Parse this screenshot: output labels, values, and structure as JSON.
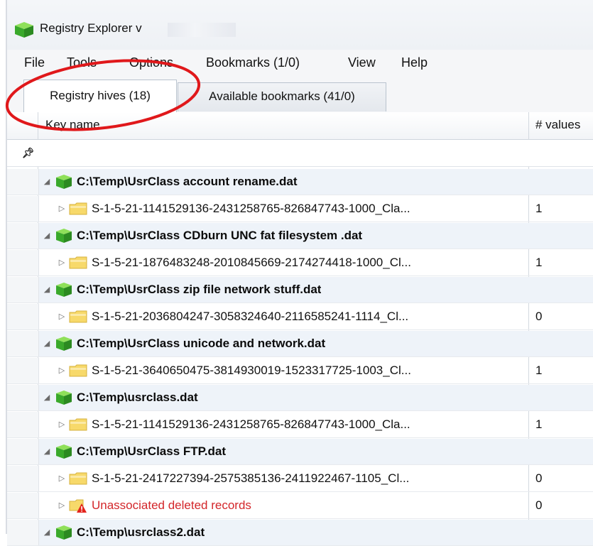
{
  "window": {
    "title": "Registry Explorer v",
    "app_icon": "green-cube-icon"
  },
  "menu": [
    "File",
    "Tools",
    "Options",
    "Bookmarks (1/0)",
    "View",
    "Help"
  ],
  "tabs": [
    {
      "label": "Registry hives (18)",
      "active": true
    },
    {
      "label": "Available bookmarks (41/0)",
      "active": false
    }
  ],
  "grid": {
    "columns": [
      "Key name",
      "# values"
    ],
    "filter_icon": "pin-filter-icon",
    "rows": [
      {
        "type": "hive",
        "name": "C:\\Temp\\UsrClass account rename.dat",
        "values": ""
      },
      {
        "type": "key",
        "name": "S-1-5-21-1141529136-2431258765-826847743-1000_Cla...",
        "values": "1"
      },
      {
        "type": "hive",
        "name": "C:\\Temp\\UsrClass CDburn UNC fat filesystem .dat",
        "values": ""
      },
      {
        "type": "key",
        "name": "S-1-5-21-1876483248-2010845669-2174274418-1000_Cl...",
        "values": "1"
      },
      {
        "type": "hive",
        "name": "C:\\Temp\\UsrClass zip file network stuff.dat",
        "values": ""
      },
      {
        "type": "key",
        "name": "S-1-5-21-2036804247-3058324640-2116585241-1114_Cl...",
        "values": "0"
      },
      {
        "type": "hive",
        "name": "C:\\Temp\\UsrClass unicode and network.dat",
        "values": ""
      },
      {
        "type": "key",
        "name": "S-1-5-21-3640650475-3814930019-1523317725-1003_Cl...",
        "values": "1"
      },
      {
        "type": "hive",
        "name": "C:\\Temp\\usrclass.dat",
        "values": ""
      },
      {
        "type": "key",
        "name": "S-1-5-21-1141529136-2431258765-826847743-1000_Cla...",
        "values": "1"
      },
      {
        "type": "hive",
        "name": "C:\\Temp\\UsrClass FTP.dat",
        "values": ""
      },
      {
        "type": "key",
        "name": "S-1-5-21-2417227394-2575385136-2411922467-1105_Cl...",
        "values": "0"
      },
      {
        "type": "deleted",
        "name": "Unassociated deleted records",
        "values": "0"
      },
      {
        "type": "hive",
        "name": "C:\\Temp\\usrclass2.dat",
        "values": ""
      }
    ]
  },
  "colors": {
    "annotation_ellipse": "#e0181b",
    "deleted_text": "#d3262a",
    "group_row_bg": "#eef3f9"
  }
}
